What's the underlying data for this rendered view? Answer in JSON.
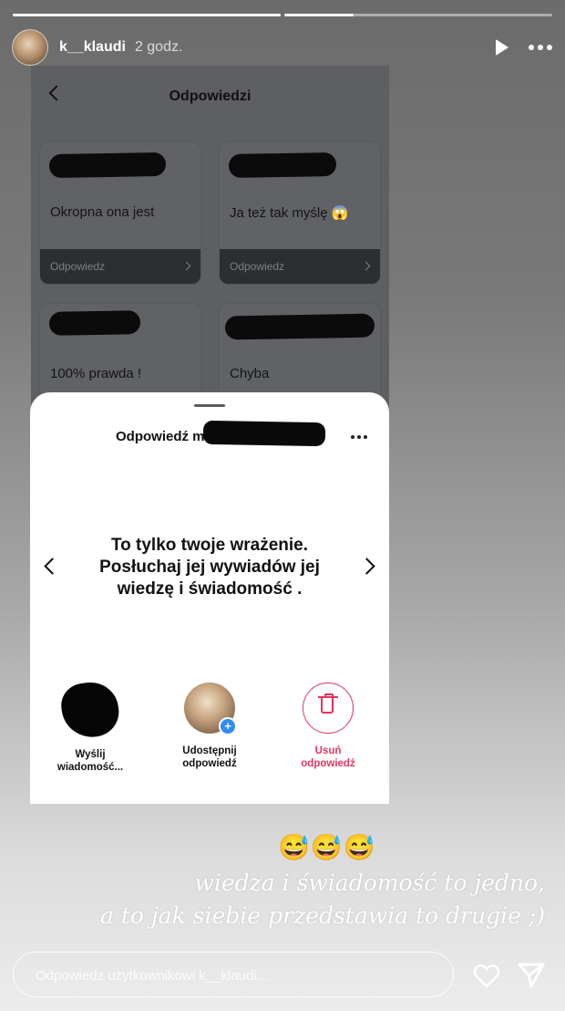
{
  "story": {
    "username": "k__klaudi",
    "time": "2 godz.",
    "progress": [
      1.0,
      0.26
    ],
    "icons": {
      "play": "play-icon",
      "more": "more-icon"
    }
  },
  "screenshot": {
    "title": "Odpowiedzi",
    "cards": [
      {
        "text": "Okropna ona jest",
        "footer": "Odpowiedz"
      },
      {
        "text": "Ja też tak myślę 😱",
        "footer": "Odpowiedz"
      },
      {
        "text": "100% prawda !"
      },
      {
        "text": "Chyba"
      }
    ]
  },
  "sheet": {
    "title": "Odpowiedź m",
    "question": "To tylko twoje wrażenie. Posłuchaj jej wywiadów jej wiedzę i świadomość .",
    "actions": [
      {
        "label_line1": "Wyślij",
        "label_line2": "wiadomość..."
      },
      {
        "label_line1": "Udostępnij",
        "label_line2": "odpowiedź"
      },
      {
        "label_line1": "Usuń",
        "label_line2": "odpowiedź"
      }
    ],
    "colors": {
      "danger": "#e2345b",
      "badge": "#2f8df5"
    }
  },
  "caption": {
    "emojis": "😅😅😅",
    "line1": "wiedza i świadomość to jedno,",
    "line2": "a to jak siebie przedstawia to drugie ;)"
  },
  "reply": {
    "placeholder": "Odpowiedz użytkownikowi k__klaudi..."
  }
}
